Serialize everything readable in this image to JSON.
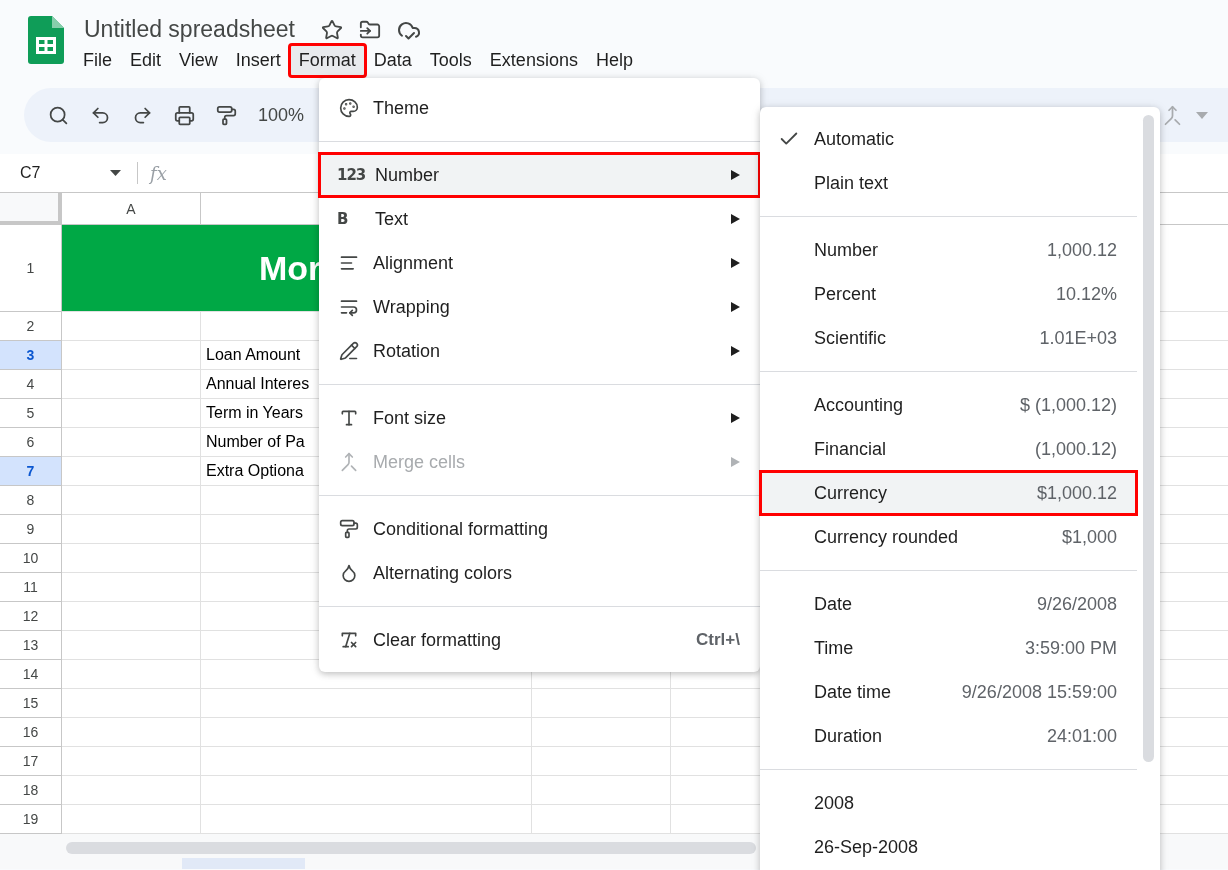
{
  "app": {
    "title": "Untitled spreadsheet"
  },
  "menu_bar": [
    {
      "label": "File",
      "selected": false
    },
    {
      "label": "Edit",
      "selected": false
    },
    {
      "label": "View",
      "selected": false
    },
    {
      "label": "Insert",
      "selected": false
    },
    {
      "label": "Format",
      "selected": true
    },
    {
      "label": "Data",
      "selected": false
    },
    {
      "label": "Tools",
      "selected": false
    },
    {
      "label": "Extensions",
      "selected": false
    },
    {
      "label": "Help",
      "selected": false
    }
  ],
  "toolbar": {
    "zoom": "100%"
  },
  "formula_bar": {
    "cell_ref": "C7",
    "function_label": "fx"
  },
  "grid": {
    "columns": [
      "A"
    ],
    "rows": [
      {
        "label": "1",
        "selected": false,
        "kind": "title",
        "text": "Mor"
      },
      {
        "label": "2",
        "selected": false,
        "kind": "plain"
      },
      {
        "label": "3",
        "selected": true,
        "kind": "plain",
        "text": "Loan Amount"
      },
      {
        "label": "4",
        "selected": false,
        "kind": "plain",
        "text": "Annual Interes"
      },
      {
        "label": "5",
        "selected": false,
        "kind": "plain",
        "text": "Term in Years"
      },
      {
        "label": "6",
        "selected": false,
        "kind": "plain",
        "text": "Number of Pa"
      },
      {
        "label": "7",
        "selected": true,
        "kind": "plain",
        "text": "Extra Optiona"
      },
      {
        "label": "8",
        "selected": false,
        "kind": "plain"
      },
      {
        "label": "9",
        "selected": false,
        "kind": "plain"
      },
      {
        "label": "10",
        "selected": false,
        "kind": "plain"
      },
      {
        "label": "11",
        "selected": false,
        "kind": "plain"
      },
      {
        "label": "12",
        "selected": false,
        "kind": "plain"
      },
      {
        "label": "13",
        "selected": false,
        "kind": "plain"
      },
      {
        "label": "14",
        "selected": false,
        "kind": "plain"
      },
      {
        "label": "15",
        "selected": false,
        "kind": "plain"
      },
      {
        "label": "16",
        "selected": false,
        "kind": "plain"
      },
      {
        "label": "17",
        "selected": false,
        "kind": "plain"
      },
      {
        "label": "18",
        "selected": false,
        "kind": "plain"
      },
      {
        "label": "19",
        "selected": false,
        "kind": "plain"
      }
    ]
  },
  "format_menu": {
    "sections": [
      [
        {
          "label": "Theme",
          "kind": "palette",
          "submenu": false,
          "selected": false,
          "disabled": false
        }
      ],
      [
        {
          "label": "Number",
          "glyph": "123",
          "submenu": true,
          "selected": true,
          "disabled": false
        },
        {
          "label": "Text",
          "glyph": "B",
          "submenu": true,
          "selected": false,
          "disabled": false
        },
        {
          "label": "Alignment",
          "kind": "align",
          "submenu": true,
          "selected": false,
          "disabled": false
        },
        {
          "label": "Wrapping",
          "kind": "wrap",
          "submenu": true,
          "selected": false,
          "disabled": false
        },
        {
          "label": "Rotation",
          "kind": "rotate",
          "submenu": true,
          "selected": false,
          "disabled": false
        }
      ],
      [
        {
          "label": "Font size",
          "kind": "fontsize",
          "submenu": true,
          "selected": false,
          "disabled": false
        },
        {
          "label": "Merge cells",
          "kind": "merge",
          "submenu": true,
          "selected": false,
          "disabled": true
        }
      ],
      [
        {
          "label": "Conditional formatting",
          "kind": "roller",
          "submenu": false,
          "selected": false,
          "disabled": false
        },
        {
          "label": "Alternating colors",
          "kind": "drop",
          "submenu": false,
          "selected": false,
          "disabled": false
        }
      ],
      [
        {
          "label": "Clear formatting",
          "kind": "clear",
          "shortcut": "Ctrl+\\",
          "submenu": false,
          "selected": false,
          "disabled": false
        }
      ]
    ]
  },
  "number_submenu": {
    "sections": [
      [
        {
          "label": "Automatic",
          "checked": true,
          "selected": false
        },
        {
          "label": "Plain text",
          "checked": false,
          "selected": false
        }
      ],
      [
        {
          "label": "Number",
          "example": "1,000.12",
          "checked": false,
          "selected": false
        },
        {
          "label": "Percent",
          "example": "10.12%",
          "checked": false,
          "selected": false
        },
        {
          "label": "Scientific",
          "example": "1.01E+03",
          "checked": false,
          "selected": false
        }
      ],
      [
        {
          "label": "Accounting",
          "example": "$ (1,000.12)",
          "checked": false,
          "selected": false
        },
        {
          "label": "Financial",
          "example": "(1,000.12)",
          "checked": false,
          "selected": false
        },
        {
          "label": "Currency",
          "example": "$1,000.12",
          "checked": false,
          "selected": true
        },
        {
          "label": "Currency rounded",
          "example": "$1,000",
          "checked": false,
          "selected": false
        }
      ],
      [
        {
          "label": "Date",
          "example": "9/26/2008",
          "checked": false,
          "selected": false
        },
        {
          "label": "Time",
          "example": "3:59:00 PM",
          "checked": false,
          "selected": false
        },
        {
          "label": "Date time",
          "example": "9/26/2008 15:59:00",
          "checked": false,
          "selected": false
        },
        {
          "label": "Duration",
          "example": "24:01:00",
          "checked": false,
          "selected": false
        }
      ],
      [
        {
          "label": "2008",
          "checked": false,
          "selected": false
        },
        {
          "label": "26-Sep-2008",
          "checked": false,
          "selected": false
        }
      ]
    ]
  }
}
